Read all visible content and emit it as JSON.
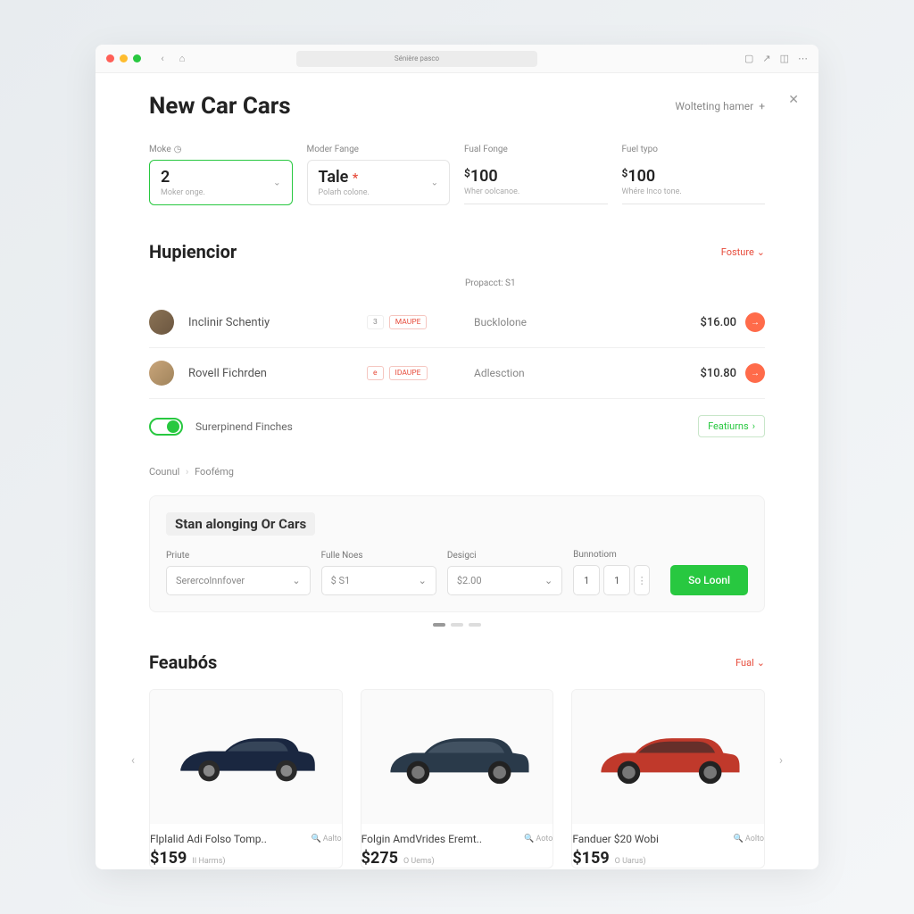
{
  "titlebar": {
    "url": "Sénière pasco"
  },
  "header": {
    "title": "New Car Cars",
    "wolting": "Wolteting hamer"
  },
  "filters": [
    {
      "label": "Moke",
      "value": "2",
      "hint": "Moker onge.",
      "icon": "clock"
    },
    {
      "label": "Moder Fange",
      "value": "Tale",
      "hint": "Polarh colone.",
      "star": true
    },
    {
      "label": "Fual Fonge",
      "value": "100",
      "hint": "Wher oolcanoe.",
      "dollar": true
    },
    {
      "label": "Fuel typo",
      "value": "100",
      "hint": "Whére Inco tone.",
      "dollar": true
    }
  ],
  "hup": {
    "title": "Hupiencior",
    "feature_link": "Fosture",
    "sub_label": "Propacct: S1",
    "rows": [
      {
        "name": "Inclinir Schentiy",
        "badge1": "3",
        "badge2": "MAUPE",
        "desc": "Bucklolone",
        "price": "$16.00"
      },
      {
        "name": "Rovell Fichrden",
        "badge1": "e",
        "badge2": "IDAUPE",
        "desc": "Adlesction",
        "price": "$10.80"
      }
    ],
    "toggle_label": "Surerpinend Finches",
    "features_btn": "Featiurns"
  },
  "breadcrumb": {
    "a": "Counul",
    "b": "Foofémg"
  },
  "panel": {
    "title": "Stan alonging Or Cars",
    "filters": [
      {
        "label": "Priute",
        "value": "Serercolnnfover"
      },
      {
        "label": "Fulle Noes",
        "value": "$ S1"
      },
      {
        "label": "Desigci",
        "value": "$2.00"
      },
      {
        "label": "Bunnotiom",
        "v1": "1",
        "v2": "1"
      }
    ],
    "submit": "So Loonl"
  },
  "featured": {
    "title": "Feaubós",
    "fuel": "Fual",
    "cards": [
      {
        "title": "Flplalid Adi Folso Tomp..",
        "meta": "Aalto",
        "price": "$159",
        "sub": "II Harms)",
        "color": "#1a2740"
      },
      {
        "title": "Folgin AmdVrides Eremt..",
        "meta": "Aoto",
        "price": "$275",
        "sub": "O Uems)",
        "color": "#2a3a4a"
      },
      {
        "title": "Fanduer $20 Wobi",
        "meta": "Aolto",
        "price": "$159",
        "sub": "O Uarus)",
        "color": "#c0392b"
      }
    ]
  }
}
